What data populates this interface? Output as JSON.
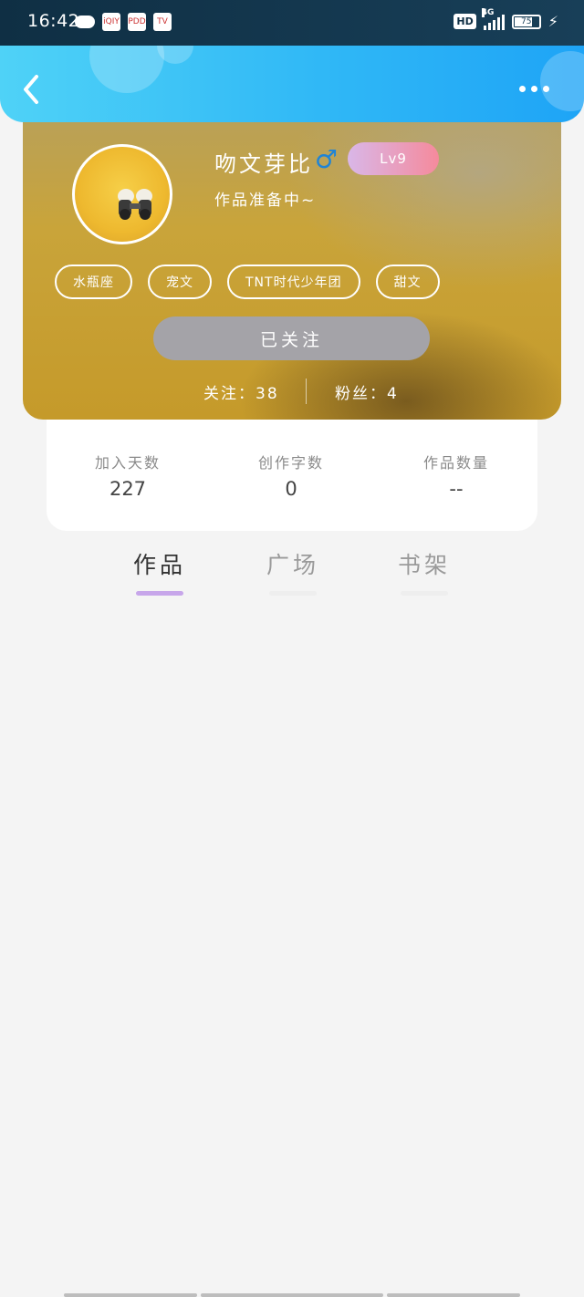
{
  "status_bar": {
    "time": "16:42",
    "network_badge": "HD",
    "network_type": "4G",
    "battery_level": "75",
    "app_icon_labels": [
      "iQIY",
      "PDD",
      "TV"
    ]
  },
  "header": {
    "back_icon": "chevron-left-icon",
    "more_icon": "more-dots-icon"
  },
  "profile": {
    "username": "吻文芽比",
    "gender_symbol": "♂",
    "level": "Lv9",
    "bio": "作品准备中~",
    "tags": [
      "水瓶座",
      "宠文",
      "TNT时代少年团",
      "甜文"
    ],
    "follow_button": "已关注",
    "following": "关注：38",
    "followers": "粉丝：4"
  },
  "stats": [
    {
      "label": "加入天数",
      "value": "227"
    },
    {
      "label": "创作字数",
      "value": "0"
    },
    {
      "label": "作品数量",
      "value": "--"
    }
  ],
  "tabs": [
    {
      "label": "作品",
      "active": true
    },
    {
      "label": "广场",
      "active": false
    },
    {
      "label": "书架",
      "active": false
    }
  ],
  "colors": {
    "header_start": "#4fd2f7",
    "header_end": "#1ea4f6",
    "tab_active_underline": "#c7a6ea",
    "follow_button_bg": "#a4a3a8",
    "level_badge_start": "#d9b7e8",
    "level_badge_end": "#f58a9c",
    "gender_color": "#1f84d6"
  }
}
